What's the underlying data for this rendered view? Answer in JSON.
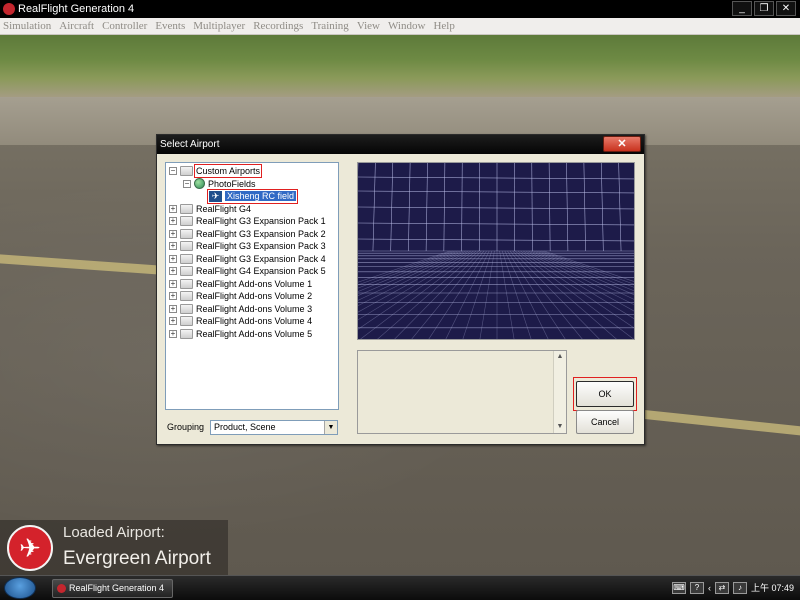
{
  "window": {
    "title": "RealFlight Generation 4",
    "min_icon": "minimize-icon",
    "max_icon": "restore-icon",
    "close_icon": "close-icon"
  },
  "menu": [
    "Simulation",
    "Aircraft",
    "Controller",
    "Events",
    "Multiplayer",
    "Recordings",
    "Training",
    "View",
    "Window",
    "Help"
  ],
  "dialog": {
    "title": "Select Airport",
    "close_glyph": "✕",
    "tree": {
      "custom_airports": "Custom Airports",
      "photofields": "PhotoFields",
      "selected_field": "Xisheng RC field",
      "items": [
        "RealFlight G4",
        "RealFlight G3 Expansion Pack 1",
        "RealFlight G3 Expansion Pack 2",
        "RealFlight G3 Expansion Pack 3",
        "RealFlight G3 Expansion Pack 4",
        "RealFlight G4 Expansion Pack 5",
        "RealFlight Add-ons Volume 1",
        "RealFlight Add-ons Volume 2",
        "RealFlight Add-ons Volume 3",
        "RealFlight Add-ons Volume 4",
        "RealFlight Add-ons Volume 5"
      ]
    },
    "grouping_label": "Grouping",
    "grouping_value": "Product, Scene",
    "ok_label": "OK",
    "cancel_label": "Cancel"
  },
  "loaded": {
    "label": "Loaded Airport:",
    "name": "Evergreen Airport"
  },
  "taskbar": {
    "app_label": "RealFlight Generation 4",
    "clock": "上午 07:49"
  },
  "colors": {
    "accent_red": "#e02020",
    "selection_blue": "#316ac5",
    "preview_bg": "#1d1b49"
  }
}
